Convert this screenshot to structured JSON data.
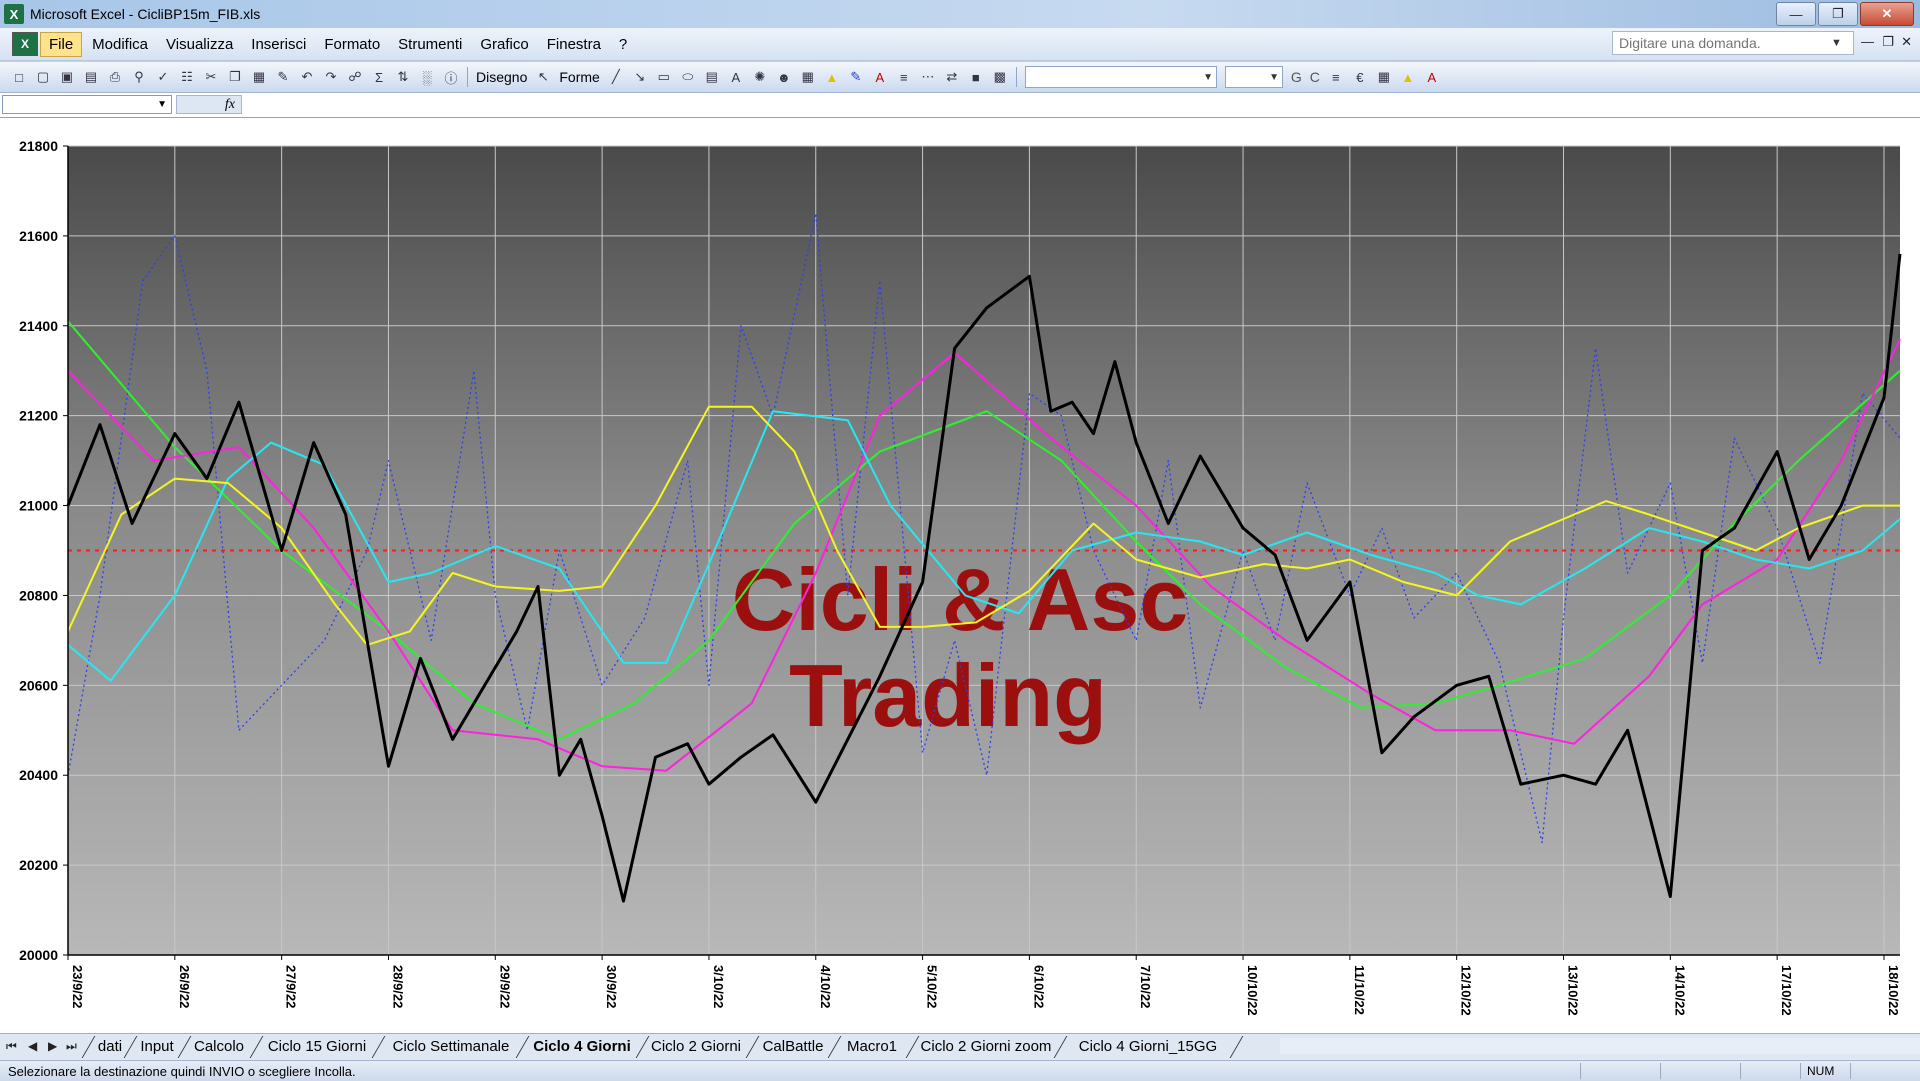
{
  "window": {
    "title": "Microsoft Excel - CicliBP15m_FIB.xls"
  },
  "menu": {
    "items": [
      "File",
      "Modifica",
      "Visualizza",
      "Inserisci",
      "Formato",
      "Strumenti",
      "Grafico",
      "Finestra",
      "?"
    ],
    "help_placeholder": "Digitare una domanda."
  },
  "toolbar": {
    "draw_label": "Disegno",
    "shapes_label": "Forme",
    "bold_label": "G",
    "italic_label": "C"
  },
  "formula_bar": {
    "fx_label": "fx"
  },
  "chart_data": {
    "type": "line",
    "watermark": [
      "Cicli & Asc",
      "Trading"
    ],
    "ylim": [
      20000,
      21800
    ],
    "yticks": [
      20000,
      20200,
      20400,
      20600,
      20800,
      21000,
      21200,
      21400,
      21600,
      21800
    ],
    "xtick_labels": [
      "23/9/22",
      "26/9/22",
      "27/9/22",
      "28/9/22",
      "29/9/22",
      "30/9/22",
      "3/10/22",
      "4/10/22",
      "5/10/22",
      "6/10/22",
      "7/10/22",
      "10/10/22",
      "11/10/22",
      "12/10/22",
      "13/10/22",
      "14/10/22",
      "17/10/22",
      "18/10/22"
    ],
    "reference_line": 20900,
    "grid": true,
    "series": [
      {
        "style": "price-black",
        "color": "#000000",
        "dashed": false,
        "x": [
          0,
          0.3,
          0.6,
          1,
          1.3,
          1.6,
          2,
          2.3,
          2.6,
          3,
          3.3,
          3.6,
          4,
          4.2,
          4.4,
          4.6,
          4.8,
          5,
          5.2,
          5.5,
          5.8,
          6,
          6.3,
          6.6,
          7,
          7.3,
          7.6,
          8,
          8.3,
          8.6,
          9,
          9.2,
          9.4,
          9.6,
          9.8,
          10,
          10.3,
          10.6,
          11,
          11.3,
          11.6,
          12,
          12.3,
          12.6,
          13,
          13.3,
          13.6,
          14,
          14.3,
          14.6,
          15,
          15.3,
          15.6,
          16,
          16.3,
          16.6,
          17,
          17.15
        ],
        "y": [
          21000,
          21180,
          20960,
          21160,
          21060,
          21230,
          20900,
          21140,
          20980,
          20420,
          20660,
          20480,
          20640,
          20720,
          20820,
          20400,
          20480,
          20310,
          20120,
          20440,
          20470,
          20380,
          20440,
          20490,
          20340,
          20480,
          20620,
          20830,
          21350,
          21440,
          21510,
          21210,
          21230,
          21160,
          21320,
          21140,
          20960,
          21110,
          20950,
          20890,
          20700,
          20830,
          20450,
          20530,
          20600,
          20620,
          20380,
          20400,
          20380,
          20500,
          20130,
          20900,
          20950,
          21120,
          20880,
          21000,
          21240,
          21560
        ]
      },
      {
        "style": "cycle-blue-dotted",
        "color": "#2b3ff5",
        "dashed": true,
        "x": [
          0,
          0.3,
          0.7,
          1,
          1.3,
          1.6,
          2,
          2.4,
          2.8,
          3,
          3.4,
          3.8,
          4,
          4.3,
          4.6,
          5,
          5.4,
          5.8,
          6,
          6.3,
          6.6,
          7,
          7.3,
          7.6,
          8,
          8.3,
          8.6,
          9,
          9.3,
          9.6,
          10,
          10.3,
          10.6,
          11,
          11.3,
          11.6,
          12,
          12.3,
          12.6,
          13,
          13.4,
          13.8,
          14,
          14.3,
          14.6,
          15,
          15.3,
          15.6,
          16,
          16.4,
          16.8,
          17.15
        ],
        "y": [
          20400,
          20800,
          21500,
          21600,
          21300,
          20500,
          20600,
          20700,
          20900,
          21100,
          20700,
          21300,
          20800,
          20500,
          20900,
          20600,
          20750,
          21100,
          20600,
          21400,
          21200,
          21650,
          20800,
          21500,
          20450,
          20700,
          20400,
          21250,
          21200,
          20900,
          20700,
          21100,
          20550,
          20900,
          20700,
          21050,
          20800,
          20950,
          20750,
          20850,
          20650,
          20250,
          20750,
          21350,
          20850,
          21050,
          20650,
          21150,
          20950,
          20650,
          21250,
          21150
        ]
      },
      {
        "style": "cycle-green",
        "color": "#2ef02e",
        "dashed": false,
        "x": [
          0,
          1,
          2,
          3,
          3.8,
          4.6,
          5.3,
          6,
          6.8,
          7.6,
          8.6,
          9.3,
          10,
          10.6,
          11.4,
          12.1,
          12.8,
          13.4,
          14.2,
          15,
          15.6,
          16.2,
          17.15
        ],
        "y": [
          21410,
          21130,
          20900,
          20720,
          20560,
          20480,
          20560,
          20700,
          20960,
          21120,
          21210,
          21100,
          20920,
          20780,
          20640,
          20550,
          20560,
          20600,
          20660,
          20800,
          20960,
          21100,
          21300
        ]
      },
      {
        "style": "cycle-magenta",
        "color": "#ff20e0",
        "dashed": false,
        "x": [
          0,
          0.8,
          1.6,
          2.3,
          3,
          3.6,
          4.4,
          5,
          5.6,
          6.4,
          7,
          7.6,
          8.3,
          9.2,
          10,
          10.7,
          11.4,
          12.2,
          12.8,
          13.5,
          14.1,
          14.8,
          15.3,
          16,
          16.6,
          17.15
        ],
        "y": [
          21300,
          21100,
          21130,
          20950,
          20720,
          20500,
          20480,
          20420,
          20410,
          20560,
          20850,
          21200,
          21340,
          21150,
          21000,
          20820,
          20700,
          20580,
          20500,
          20500,
          20470,
          20620,
          20780,
          20880,
          21100,
          21370
        ]
      },
      {
        "style": "cycle-cyan",
        "color": "#25e8f0",
        "dashed": false,
        "x": [
          0,
          0.4,
          1,
          1.5,
          1.9,
          2.4,
          3,
          3.4,
          4,
          4.6,
          5.2,
          5.6,
          6,
          6.6,
          7.3,
          7.7,
          8.4,
          8.9,
          9.4,
          10,
          10.6,
          11,
          11.6,
          12.2,
          12.8,
          13.2,
          13.6,
          14.2,
          14.8,
          15.3,
          15.8,
          16.3,
          16.8,
          17.15
        ],
        "y": [
          20690,
          20610,
          20800,
          21060,
          21140,
          21090,
          20830,
          20850,
          20910,
          20860,
          20650,
          20650,
          20870,
          21210,
          21190,
          21000,
          20800,
          20760,
          20900,
          20940,
          20920,
          20890,
          20940,
          20890,
          20850,
          20800,
          20780,
          20860,
          20950,
          20920,
          20880,
          20860,
          20900,
          20970
        ]
      },
      {
        "style": "cycle-yellow",
        "color": "#f5f520",
        "dashed": false,
        "x": [
          0,
          0.5,
          1,
          1.5,
          2,
          2.5,
          2.8,
          3.2,
          3.6,
          4,
          4.6,
          5,
          5.5,
          6,
          6.4,
          6.8,
          7.2,
          7.6,
          8,
          8.5,
          9,
          9.6,
          10,
          10.6,
          11.2,
          11.6,
          12,
          12.5,
          13,
          13.5,
          14,
          14.4,
          14.8,
          15.3,
          15.8,
          16.2,
          16.8,
          17.15
        ],
        "y": [
          20720,
          20980,
          21060,
          21050,
          20950,
          20780,
          20690,
          20720,
          20850,
          20820,
          20810,
          20820,
          21000,
          21220,
          21220,
          21120,
          20900,
          20730,
          20730,
          20740,
          20810,
          20960,
          20880,
          20840,
          20870,
          20860,
          20880,
          20830,
          20800,
          20920,
          20970,
          21010,
          20980,
          20940,
          20900,
          20950,
          21000,
          21000
        ]
      }
    ]
  },
  "sheet_tabs": {
    "tabs": [
      "dati",
      "Input",
      "Calcolo",
      "Ciclo 15 Giorni",
      "Ciclo Settimanale",
      "Ciclo 4 Giorni",
      "Ciclo 2 Giorni",
      "CalBattle",
      "Macro1",
      "Ciclo 2 Giorni zoom",
      "Ciclo 4 Giorni_15GG"
    ],
    "active": "Ciclo 4 Giorni"
  },
  "status": {
    "message": "Selezionare la destinazione quindi INVIO o scegliere Incolla.",
    "num": "NUM"
  }
}
